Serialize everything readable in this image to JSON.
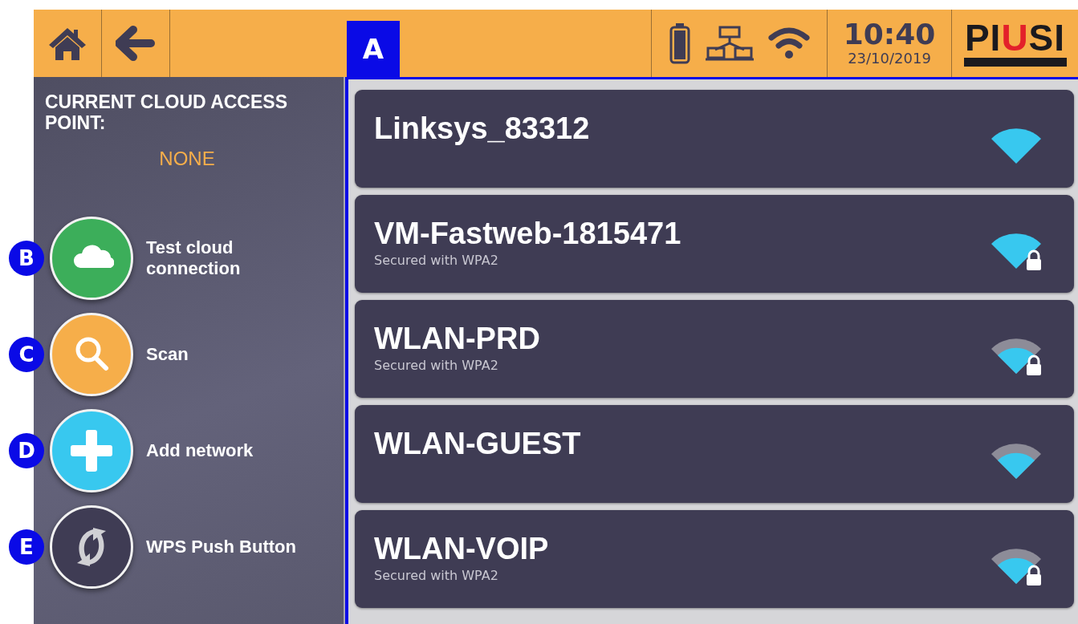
{
  "header": {
    "time": "10:40",
    "date": "23/10/2019",
    "logo": "PIUSI"
  },
  "panel_callout": {
    "label": "A"
  },
  "cloud_status": {
    "title": "CURRENT CLOUD ACCESS POINT:",
    "value": "NONE"
  },
  "actions": [
    {
      "kind": "cloud",
      "label": "Test cloud connection",
      "color": "#3cae5a",
      "callout": "B"
    },
    {
      "kind": "search",
      "label": "Scan",
      "color": "#f6ae4a",
      "callout": "C"
    },
    {
      "kind": "add",
      "label": "Add network",
      "color": "#38c8ef",
      "callout": "D"
    },
    {
      "kind": "wps",
      "label": "WPS Push Button",
      "color": "#3f3c54",
      "callout": "E"
    }
  ],
  "networks": [
    {
      "name": "Linksys_83312",
      "secured": false,
      "kind": "full"
    },
    {
      "name": "VM-Fastweb-1815471",
      "security": "Secured with WPA2",
      "secured": true,
      "kind": "full"
    },
    {
      "name": "WLAN-PRD",
      "security": "Secured with WPA2",
      "secured": true,
      "kind": "partial"
    },
    {
      "name": "WLAN-GUEST",
      "secured": false,
      "kind": "partial"
    },
    {
      "name": "WLAN-VOIP",
      "security": "Secured with WPA2",
      "secured": true,
      "kind": "partial"
    }
  ]
}
